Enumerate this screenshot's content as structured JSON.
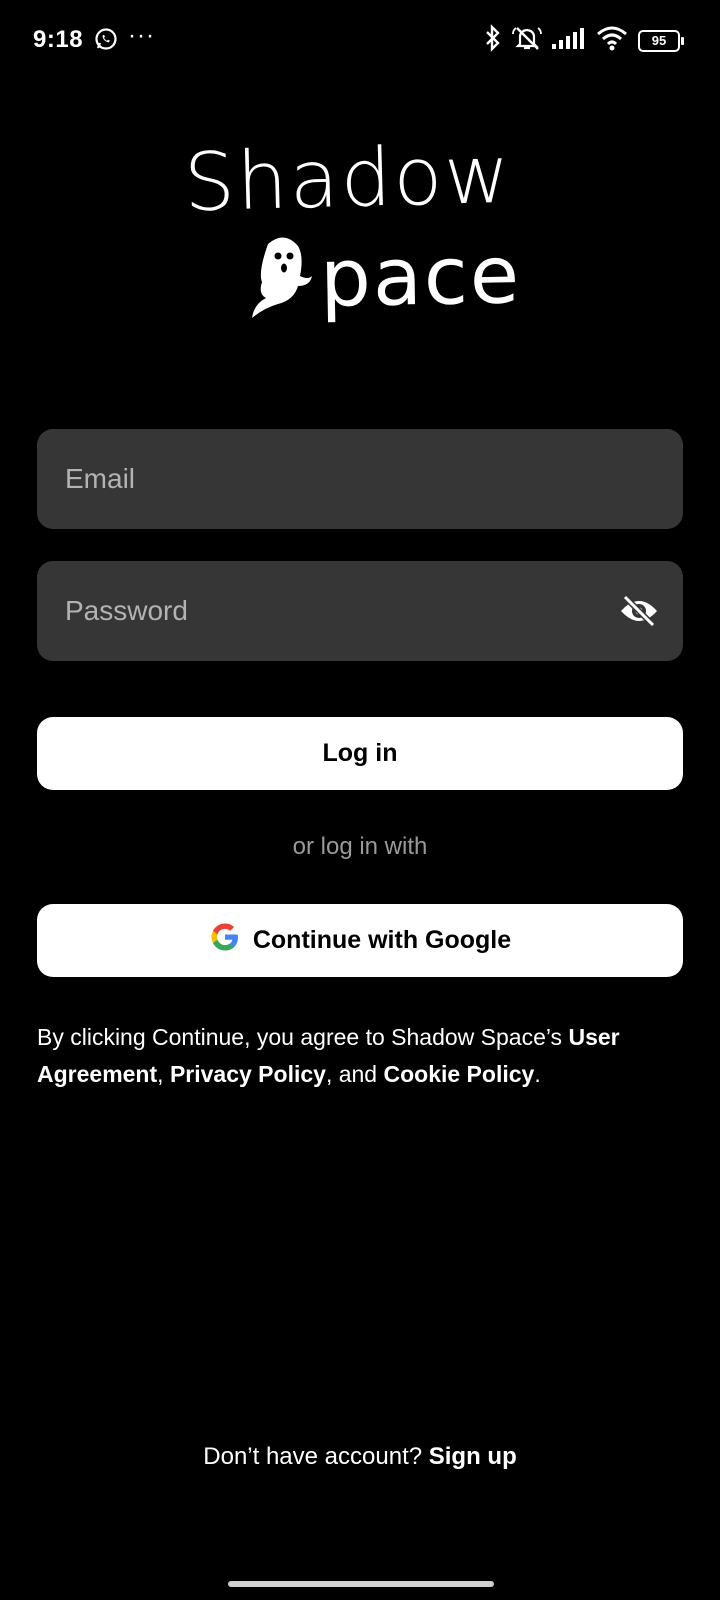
{
  "status_bar": {
    "time": "9:18",
    "more": "···",
    "battery": "95"
  },
  "logo": {
    "line1": "Shadow",
    "line2": "pace",
    "icon": "ghost-icon"
  },
  "form": {
    "email_placeholder": "Email",
    "password_placeholder": "Password",
    "password_toggle_icon": "eye-off-icon"
  },
  "login_label": "Log in",
  "divider_text": "or log in with",
  "google": {
    "label": "Continue with Google",
    "icon": "google-icon"
  },
  "terms": {
    "prefix": "By clicking Continue, you agree to Shadow Space’s ",
    "user_agreement": "User Agreement",
    "sep1": ", ",
    "privacy_policy": "Privacy Policy",
    "sep2": ", and ",
    "cookie_policy": "Cookie Policy",
    "suffix": "."
  },
  "footer": {
    "question": "Don’t have account? ",
    "signup_label": "Sign up"
  },
  "colors": {
    "background": "#000000",
    "field_bg": "#363636",
    "button_bg": "#ffffff",
    "muted_text": "#9a9a9a"
  }
}
